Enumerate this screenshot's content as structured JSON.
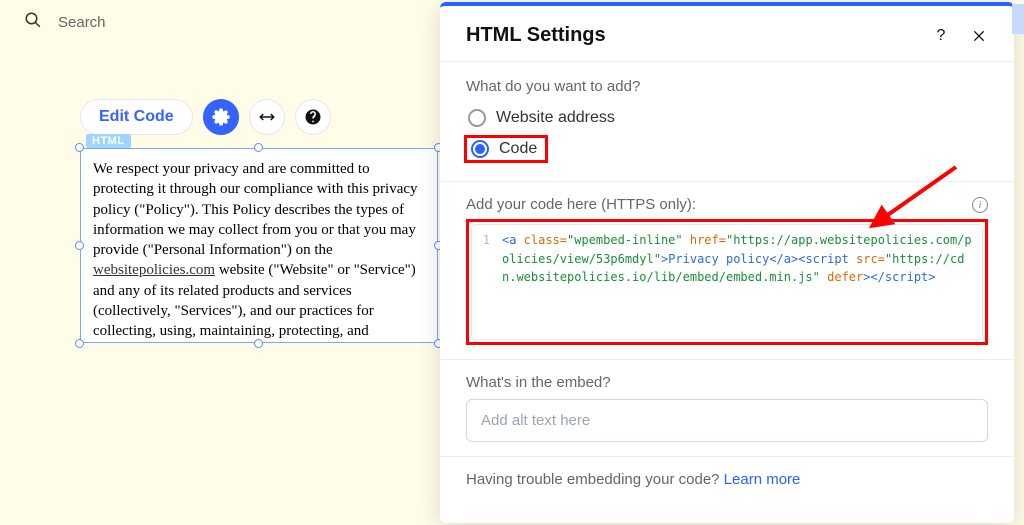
{
  "search": {
    "placeholder": "Search"
  },
  "toolbar": {
    "edit_label": "Edit Code"
  },
  "html_block": {
    "badge": "HTML",
    "text_before": "We respect your privacy and are committed to protecting it through our compliance with this privacy policy (\"Policy\"). This Policy describes the types of information we may collect from you or that you may provide (\"Personal Information\") on the ",
    "link_text": "websitepolicies.com",
    "text_after": " website (\"Website\" or \"Service\") and any of its related products and services (collectively, \"Services\"), and our practices for collecting, using, maintaining, protecting, and disclosing that Personal"
  },
  "modal": {
    "title": "HTML Settings",
    "q1": "What do you want to add?",
    "opt_website": "Website address",
    "opt_code": "Code",
    "code_label": "Add your code here (HTTPS only):",
    "code_line_no": "1",
    "code": {
      "a_open": "<a",
      "class_attr": " class=",
      "class_val": "\"wpembed-inline\"",
      "href_attr": "href=",
      "href_val": "\"https://app.websitepolicies.com/policies/view/53p6mdyl\"",
      "a_text": ">Privacy policy</a>",
      "script_open": "<script",
      "src_attr": "src=",
      "src_val": "\"https://cdn.websitepolicies.io/lib/embed/embed.min.js\"",
      "defer_attr": " defer",
      "script_close": "></script>"
    },
    "embed_q": "What's in the embed?",
    "alt_placeholder": "Add alt text here",
    "trouble_text": "Having trouble embedding your code? ",
    "trouble_link": "Learn more"
  }
}
